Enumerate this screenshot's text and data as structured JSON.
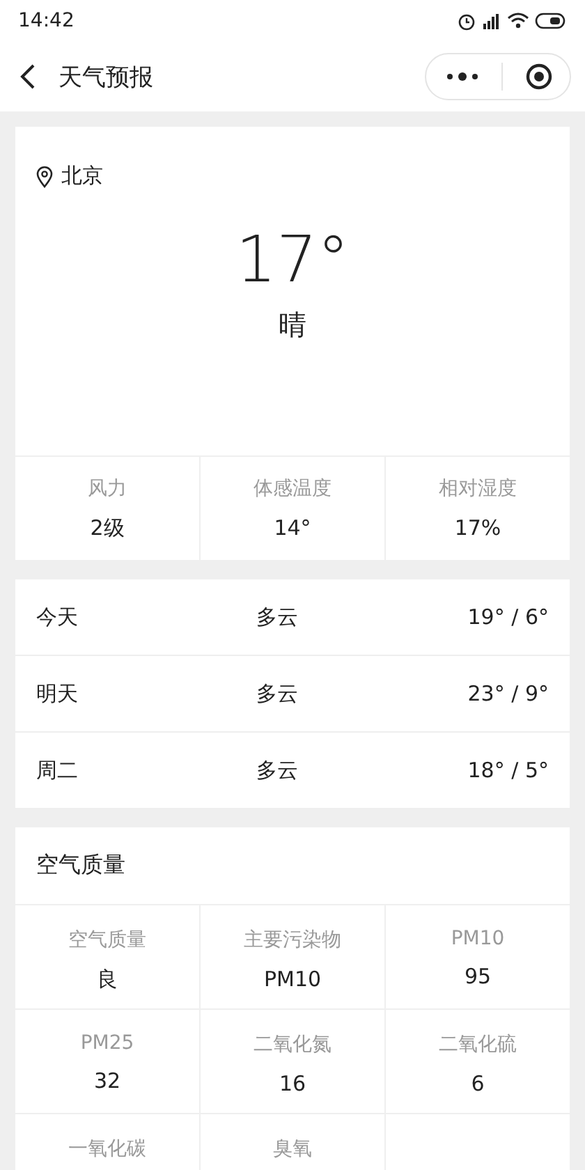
{
  "status_bar": {
    "time": "14:42"
  },
  "nav": {
    "title": "天气预报"
  },
  "current": {
    "city": "北京",
    "temperature": "17°",
    "condition": "晴",
    "stats": [
      {
        "label": "风力",
        "value": "2级"
      },
      {
        "label": "体感温度",
        "value": "14°"
      },
      {
        "label": "相对湿度",
        "value": "17%"
      }
    ]
  },
  "forecast": [
    {
      "day": "今天",
      "condition": "多云",
      "range": "19° / 6°"
    },
    {
      "day": "明天",
      "condition": "多云",
      "range": "23° / 9°"
    },
    {
      "day": "周二",
      "condition": "多云",
      "range": "18° / 5°"
    }
  ],
  "air_quality": {
    "title": "空气质量",
    "items": [
      {
        "label": "空气质量",
        "value": "良"
      },
      {
        "label": "主要污染物",
        "value": "PM10"
      },
      {
        "label": "PM10",
        "value": "95"
      },
      {
        "label": "PM25",
        "value": "32"
      },
      {
        "label": "二氧化氮",
        "value": "16"
      },
      {
        "label": "二氧化硫",
        "value": "6"
      },
      {
        "label": "一氧化碳"
      },
      {
        "label": "臭氧"
      }
    ]
  }
}
